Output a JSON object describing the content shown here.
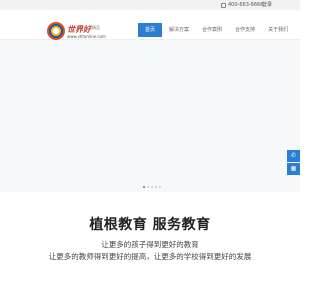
{
  "topbar": {
    "phone": "400-663-6666",
    "login": "登录"
  },
  "logo": {
    "name": "世界好",
    "tag": "精品",
    "url": "www.shtonline.com"
  },
  "nav": {
    "items": [
      {
        "label": "首页",
        "active": true
      },
      {
        "label": "解决方案",
        "active": false
      },
      {
        "label": "合作案例",
        "active": false
      },
      {
        "label": "合作支持",
        "active": false
      },
      {
        "label": "关于我们",
        "active": false
      }
    ]
  },
  "hero": {
    "slide_count": 5,
    "active_index": 0
  },
  "float_widget": {
    "icons": [
      "phone-icon",
      "qr-icon"
    ]
  },
  "slogan": {
    "title": "植根教育 服务教育",
    "line1": "让更多的孩子得到更好的教育",
    "line2": "让更多的教师得到更好的提高，让更多的学校得到更好的发展"
  },
  "colors": {
    "accent": "#2a7fd4",
    "topbar_bg": "#f2f2f2",
    "hero_bg": "#f7f8fa"
  }
}
